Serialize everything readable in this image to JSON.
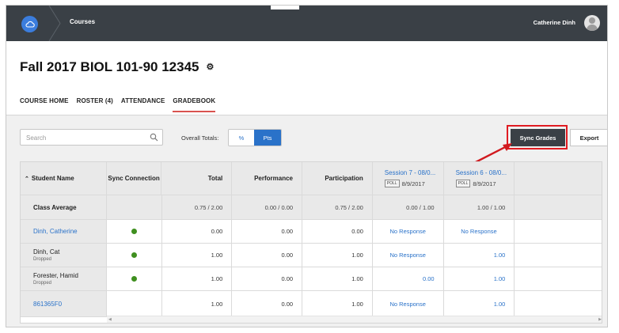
{
  "topbar": {
    "logo_icon": "cloud-logo-icon",
    "breadcrumb": "Courses",
    "user_name": "Catherine Dinh",
    "avatar_icon": "user-avatar-icon"
  },
  "course": {
    "title": "Fall 2017 BIOL 101-90 12345",
    "settings_icon": "gear-icon"
  },
  "tabs": [
    {
      "label": "COURSE HOME",
      "active": false
    },
    {
      "label": "ROSTER (4)",
      "active": false
    },
    {
      "label": "ATTENDANCE",
      "active": false
    },
    {
      "label": "GRADEBOOK",
      "active": true
    }
  ],
  "toolbar": {
    "search_placeholder": "Search",
    "overall_totals_label": "Overall Totals:",
    "percent_label": "%",
    "points_label": "Pts",
    "sync_label": "Sync Grades",
    "export_label": "Export"
  },
  "colors": {
    "topbar": "#3a4046",
    "accent": "#2a72c9",
    "highlight": "#e01b22",
    "sync_dot": "#3f8f1f"
  },
  "grid": {
    "headers": {
      "student": "Student Name",
      "sync": "Sync Connection",
      "total": "Total",
      "performance": "Performance",
      "participation": "Participation"
    },
    "sessions": [
      {
        "title": "Session 7 - 08/0...",
        "badge": "POLL",
        "date": "8/9/2017"
      },
      {
        "title": "Session 6 - 08/0...",
        "badge": "POLL",
        "date": "8/9/2017"
      }
    ],
    "average": {
      "label": "Class Average",
      "total": "0.75 / 2.00",
      "performance": "0.00 / 0.00",
      "participation": "0.75 / 2.00",
      "s7": "0.00 / 1.00",
      "s6": "1.00 / 1.00"
    },
    "rows": [
      {
        "name": "Dinh, Catherine",
        "status": "",
        "synced": true,
        "total": "0.00",
        "performance": "0.00",
        "participation": "0.00",
        "s7": "No Response",
        "s6": "No Response"
      },
      {
        "name": "Dinh, Cat",
        "status": "Dropped",
        "synced": true,
        "total": "1.00",
        "performance": "0.00",
        "participation": "1.00",
        "s7": "No Response",
        "s6": "1.00"
      },
      {
        "name": "Forester, Hamid",
        "status": "Dropped",
        "synced": true,
        "total": "1.00",
        "performance": "0.00",
        "participation": "1.00",
        "s7": "0.00",
        "s6": "1.00"
      },
      {
        "name": "861365F0",
        "status": "",
        "synced": false,
        "total": "1.00",
        "performance": "0.00",
        "participation": "1.00",
        "s7": "No Response",
        "s6": "1.00"
      }
    ]
  }
}
